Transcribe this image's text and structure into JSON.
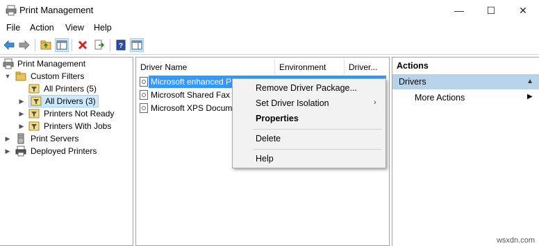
{
  "window": {
    "title": "Print Management",
    "controls": {
      "minimize": "—",
      "maximize": "☐",
      "close": "✕"
    }
  },
  "menu": [
    "File",
    "Action",
    "View",
    "Help"
  ],
  "toolbar": {
    "buttons": [
      "back-icon",
      "forward-icon",
      "up-folder-icon",
      "show-hide-tree-icon",
      "delete-icon",
      "export-icon",
      "help-icon",
      "action-pane-icon"
    ]
  },
  "tree": {
    "root": "Print Management",
    "custom_filters": "Custom Filters",
    "all_printers": "All Printers (5)",
    "all_drivers": "All Drivers (3)",
    "printers_not_ready": "Printers Not Ready",
    "printers_with_jobs": "Printers With Jobs",
    "print_servers": "Print Servers",
    "deployed_printers": "Deployed Printers"
  },
  "list": {
    "columns": [
      "Driver Name",
      "Environment",
      "Driver..."
    ],
    "rows": [
      {
        "name": "Microsoft enhanced P",
        "selected": true
      },
      {
        "name": "Microsoft Shared Fax D",
        "selected": false
      },
      {
        "name": "Microsoft XPS Docum",
        "selected": false
      }
    ]
  },
  "actions": {
    "header": "Actions",
    "section": "Drivers",
    "more": "More Actions"
  },
  "context_menu": {
    "items": [
      "Remove Driver Package...",
      "Set Driver Isolation",
      "Properties",
      "Delete",
      "Help"
    ]
  },
  "watermark": "wsxdn.com",
  "colors": {
    "selection": "#cce8ff",
    "selection_border": "#99d1ff",
    "actions_section": "#b7d3ea",
    "list_selected": "#3399ff"
  }
}
